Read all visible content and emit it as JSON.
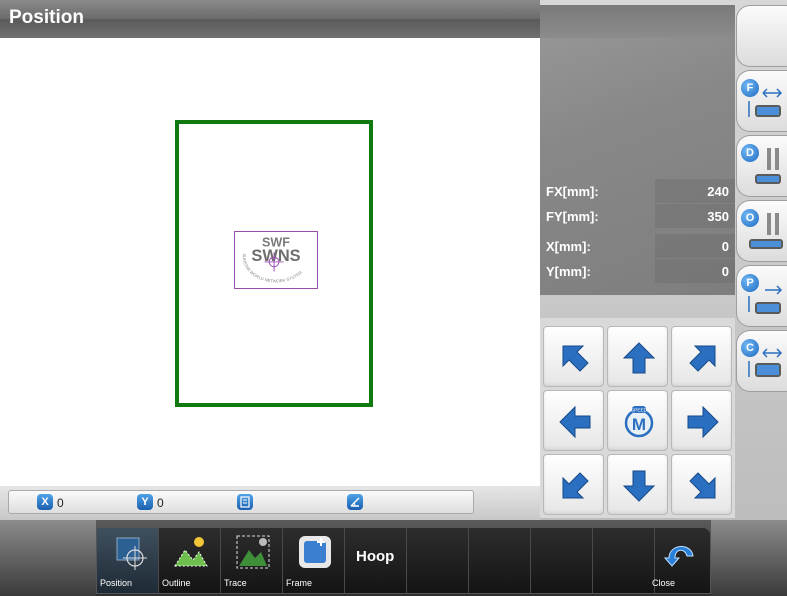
{
  "title": "Position",
  "status": {
    "x_value": "0",
    "y_value": "0",
    "x_icon_label": "X",
    "y_icon_label": "Y"
  },
  "info": {
    "rows": [
      {
        "label": "FX[mm]:",
        "value": "240"
      },
      {
        "label": "FY[mm]:",
        "value": "350"
      },
      {
        "label": "X[mm]:",
        "value": "0"
      },
      {
        "label": "Y[mm]:",
        "value": "0"
      }
    ]
  },
  "design": {
    "logo_top": "SWF",
    "logo_main": "SWNS",
    "logo_ring": "SUNSTAR WORLD NETWORK SYSTEM"
  },
  "pad": {
    "speed_label": "SPEED",
    "center_letter": "M"
  },
  "tools": [
    {
      "badge": "F",
      "icon": "frame-move-icon"
    },
    {
      "badge": "D",
      "icon": "needle-down-icon"
    },
    {
      "badge": "O",
      "icon": "origin-icon"
    },
    {
      "badge": "P",
      "icon": "position-icon"
    },
    {
      "badge": "C",
      "icon": "center-icon"
    }
  ],
  "toolbar": {
    "position_label": "Position",
    "outline_label": "Outline",
    "trace_label": "Trace",
    "frame_label": "Frame",
    "hoop_label": "Hoop",
    "close_label": "Close"
  },
  "colors": {
    "hoop_border": "#107a10",
    "design_border": "#9a4fb0",
    "arrow_blue": "#2a6fc0",
    "badge_blue": "#1d6ac0"
  }
}
